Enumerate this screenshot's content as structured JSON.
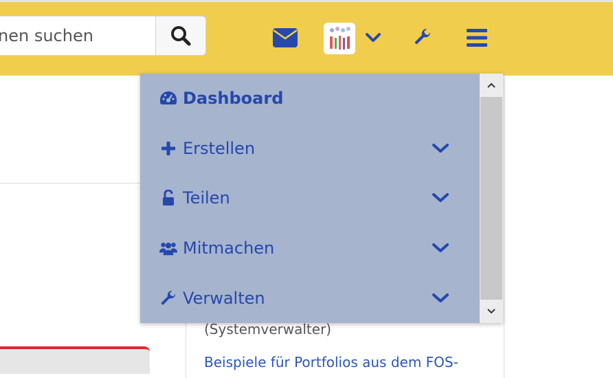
{
  "search": {
    "placeholder": "nen suchen"
  },
  "header": {
    "icons": [
      "search-icon",
      "envelope-icon",
      "chevron-down-icon",
      "wrench-icon",
      "bars-icon"
    ],
    "accent_color": "#f0cd4d",
    "icon_color": "#2549ad"
  },
  "menu": {
    "items": [
      {
        "label": "Dashboard",
        "icon": "dashboard-icon"
      },
      {
        "label": "Erstellen",
        "icon": "plus-icon"
      },
      {
        "label": "Teilen",
        "icon": "unlock-icon"
      },
      {
        "label": "Mitmachen",
        "icon": "users-icon"
      },
      {
        "label": "Verwalten",
        "icon": "wrench-icon"
      }
    ],
    "background": "#a6b4cd"
  },
  "sidebar": {
    "role": "(Systemverwalter)",
    "link": "Beispiele für Portfolios aus dem FOS-"
  }
}
